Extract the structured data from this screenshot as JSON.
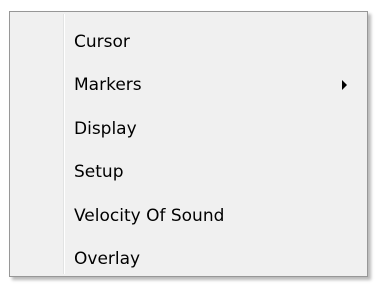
{
  "context_menu": {
    "items": [
      {
        "label": "Cursor",
        "has_submenu": false
      },
      {
        "label": "Markers",
        "has_submenu": true
      },
      {
        "label": "Display",
        "has_submenu": false
      },
      {
        "label": "Setup",
        "has_submenu": false
      },
      {
        "label": "Velocity Of Sound",
        "has_submenu": false
      },
      {
        "label": "Overlay",
        "has_submenu": false
      }
    ]
  },
  "icons": {
    "submenu_indicator": "chevron-right-icon"
  },
  "colors": {
    "menu_background": "#f0f0f0",
    "menu_border": "#979797",
    "text": "#000000"
  }
}
